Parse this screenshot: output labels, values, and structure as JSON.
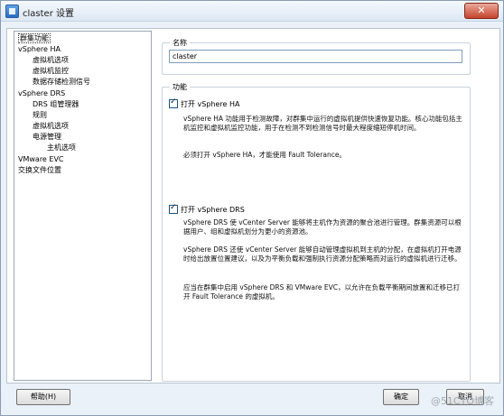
{
  "window": {
    "title": "claster 设置",
    "close_symbol": "✕"
  },
  "nav": {
    "items": [
      {
        "label": "群集功能",
        "indent": 0,
        "selected": true
      },
      {
        "label": "vSphere HA",
        "indent": 0
      },
      {
        "label": "虚拟机选项",
        "indent": 1
      },
      {
        "label": "虚拟机监控",
        "indent": 1
      },
      {
        "label": "数据存储检测信号",
        "indent": 1
      },
      {
        "label": "vSphere DRS",
        "indent": 0
      },
      {
        "label": "DRS 组管理器",
        "indent": 1
      },
      {
        "label": "规则",
        "indent": 1
      },
      {
        "label": "虚拟机选项",
        "indent": 1
      },
      {
        "label": "电源管理",
        "indent": 1
      },
      {
        "label": "主机选项",
        "indent": 2
      },
      {
        "label": "VMware EVC",
        "indent": 0
      },
      {
        "label": "交换文件位置",
        "indent": 0
      }
    ]
  },
  "name_group": {
    "title": "名称",
    "value": "claster"
  },
  "features_group": {
    "title": "功能",
    "ha": {
      "label": "打开 vSphere HA",
      "checked": true,
      "desc1": "vSphere HA 功能用于检测故障，对群集中运行的虚拟机提供快速恢复功能。核心功能包括主机监控和虚拟机监控功能，用于在检测不到检测信号时最大程度缩短停机时间。",
      "desc2": "必须打开 vSphere HA，才能使用 Fault Tolerance。"
    },
    "drs": {
      "label": "打开 vSphere DRS",
      "checked": true,
      "desc1": "vSphere DRS 使 vCenter Server 能够将主机作为资源的聚合池进行管理。群集资源可以根据用户、组和虚拟机划分为更小的资源池。",
      "desc2": "vSphere DRS 还使 vCenter Server 能够自动管理虚拟机到主机的分配，在虚拟机打开电源时给出放置位置建议，以及为平衡负载和强制执行资源分配策略而对运行的虚拟机进行迁移。",
      "desc3": "应当在群集中启用 vSphere DRS 和 VMware EVC，以允许在负载平衡期间放置和迁移已打开 Fault Tolerance 的虚拟机。"
    }
  },
  "buttons": {
    "help": "帮助(H)",
    "ok": "确定",
    "cancel": "取消"
  },
  "watermark": "@51CTO博客",
  "colors": {
    "accent": "#2c6cbf",
    "border": "#9aa8b6",
    "background": "#eaf1f8"
  }
}
